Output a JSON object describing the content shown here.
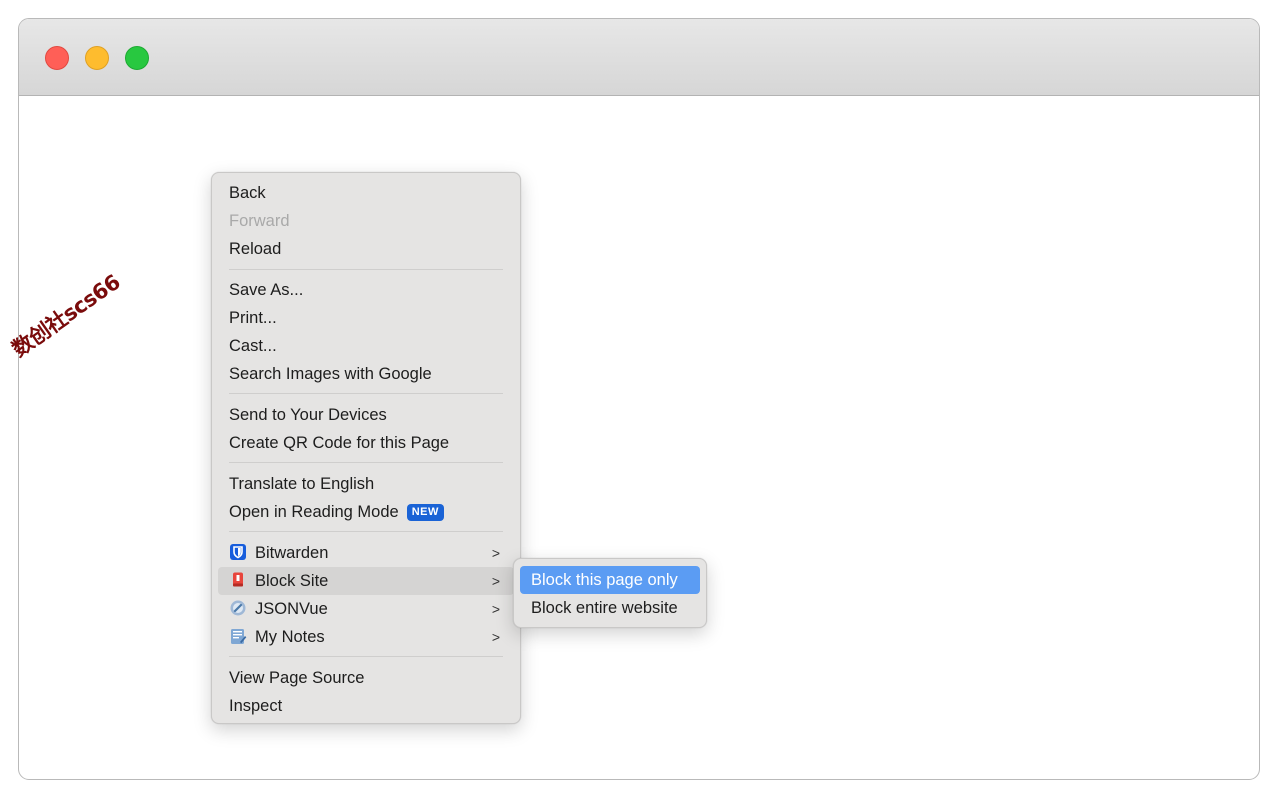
{
  "window": {
    "traffic_lights": [
      "close",
      "minimize",
      "zoom"
    ]
  },
  "watermark": "数创社scs66",
  "context_menu": {
    "back": "Back",
    "forward": "Forward",
    "reload": "Reload",
    "save_as": "Save As...",
    "print": "Print...",
    "cast": "Cast...",
    "search_images": "Search Images with Google",
    "send_devices": "Send to Your Devices",
    "create_qr": "Create QR Code for this Page",
    "translate": "Translate to English",
    "reading_mode": "Open in Reading Mode",
    "reading_mode_badge": "NEW",
    "bitwarden": "Bitwarden",
    "block_site": "Block Site",
    "jsonvue": "JSONVue",
    "my_notes": "My Notes",
    "view_source": "View Page Source",
    "inspect": "Inspect",
    "chevron": ">"
  },
  "submenu": {
    "block_page": "Block this page only",
    "block_website": "Block entire website"
  },
  "colors": {
    "highlight": "#5b9cf3",
    "badge": "#1a63d6",
    "watermark": "#7a0b0b"
  }
}
